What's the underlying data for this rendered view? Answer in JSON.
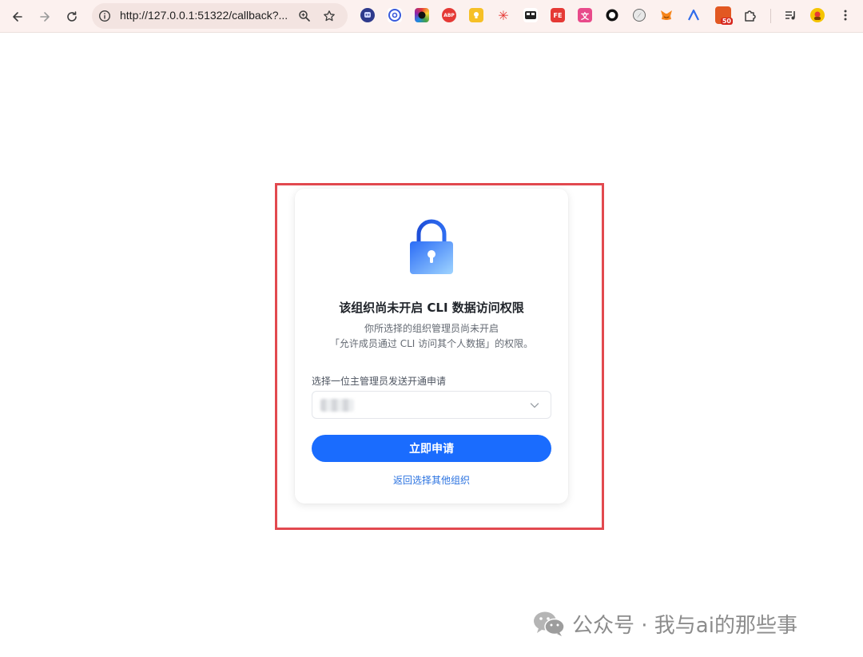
{
  "browser": {
    "url": "http://127.0.0.1:51322/callback?...",
    "nav": [
      "back-icon",
      "forward-icon",
      "reload-icon"
    ],
    "omnibox_icons": [
      "site-info-icon",
      "zoom-icon",
      "bookmark-star-icon"
    ],
    "extensions": [
      {
        "name": "ext-robot-icon",
        "color": "#2e3a8c",
        "glyph": ""
      },
      {
        "name": "ext-at-icon",
        "color": "#3b5bdb",
        "glyph": "@"
      },
      {
        "name": "ext-color-picker-icon",
        "color": "#7b3fe4",
        "glyph": ""
      },
      {
        "name": "ext-adblock-plus-icon",
        "color": "#e53935",
        "glyph": "ABP"
      },
      {
        "name": "ext-keep-icon",
        "color": "#f6c026",
        "glyph": ""
      },
      {
        "name": "ext-sparkle-icon",
        "color": "#ffffff",
        "glyph": "✳"
      },
      {
        "name": "ext-gamepad-icon",
        "color": "#222222",
        "glyph": ""
      },
      {
        "name": "ext-fe-icon",
        "color": "#e53935",
        "glyph": "FE"
      },
      {
        "name": "ext-translate-icon",
        "color": "#e84a8a",
        "glyph": "文"
      },
      {
        "name": "ext-circle-icon",
        "color": "#111111",
        "glyph": ""
      },
      {
        "name": "ext-compass-icon",
        "color": "#555555",
        "glyph": ""
      },
      {
        "name": "ext-metamask-icon",
        "color": "#ffffff",
        "glyph": ""
      },
      {
        "name": "ext-arc-icon",
        "color": "#ffffff",
        "glyph": ""
      },
      {
        "name": "ext-badge-icon",
        "color": "#e25822",
        "glyph": ""
      },
      {
        "name": "ext-puzzle-icon",
        "color": "#ffffff",
        "glyph": ""
      },
      {
        "name": "ext-media-icon",
        "color": "#ffffff",
        "glyph": ""
      },
      {
        "name": "ext-avatar-icon",
        "color": "#f5c400",
        "glyph": ""
      },
      {
        "name": "menu-icon",
        "color": "#ffffff",
        "glyph": ""
      }
    ],
    "badge_count": "50"
  },
  "card": {
    "title": "该组织尚未开启 CLI 数据访问权限",
    "desc_line1": "你所选择的组织管理员尚未开启",
    "desc_line2": "「允许成员通过 CLI 访问其个人数据」的权限。",
    "field_label": "选择一位主管理员发送开通申请",
    "select_value": "",
    "apply_button": "立即申请",
    "back_link": "返回选择其他组织"
  },
  "colors": {
    "primary": "#1a6cfe",
    "link": "#2a72e0",
    "highlight_border": "#e2494f",
    "toolbar_bg": "#fcf1ef"
  },
  "watermark": {
    "text": "公众号 · 我与ai的那些事"
  }
}
